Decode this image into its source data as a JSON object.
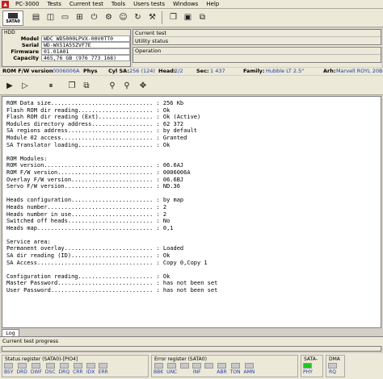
{
  "menu": [
    "PC-3000",
    "Tests",
    "Current test",
    "Tools",
    "Users tests",
    "Windows",
    "Help"
  ],
  "toolbar": {
    "sata_label": "SATA0"
  },
  "hdd": {
    "title": "HDD",
    "rows": [
      {
        "label": "Model",
        "value": "WDC WD5000LPVX-00V0TT0"
      },
      {
        "label": "Serial",
        "value": "WD-WX51A55ZVF7E"
      },
      {
        "label": "Firmware",
        "value": "01.01A01"
      },
      {
        "label": "Capacity",
        "value": "465,76 GB (976 773 168)"
      }
    ]
  },
  "current_test": {
    "header": "Current test",
    "value": "Utility status"
  },
  "operation": {
    "header": "Operation",
    "value": ""
  },
  "statusline": {
    "rom_label": "ROM F/W version",
    "rom_value": "0006006A",
    "phys_label": "Phys",
    "cyl_label": "Cyl SA:",
    "cyl_value": "256 (124)",
    "head_label": "Head:",
    "head_value": "2/2",
    "sec_label": "Sec:",
    "sec_value": "1 437",
    "family_label": "Family:",
    "family_value": "Hubble LT 2.5\"",
    "arh_label": "Arh:",
    "arh_value": "Marvell ROYL 20B"
  },
  "console_lines": [
    "ROM Data size.............................. : 256 Kb",
    "Flash ROM dir reading...................... : Ok",
    "Flash ROM dir reading (Ext)................ : Ok (Active)",
    "Modules directory address.................. : 62 372",
    "SA regions address......................... : by default",
    "Module 02 access........................... : Granted",
    "SA Translator loading...................... : Ok",
    "",
    "ROM Modules:",
    "ROM version................................ : 06.6AJ",
    "ROM F/W version............................ : 0006006A",
    "Overlay F/W version........................ : 06.6BJ",
    "Servo F/W version.......................... : ND.36",
    "",
    "Heads configuration........................ : by map",
    "Heads number............................... : 2",
    "Heads number in use........................ : 2",
    "Switched off heads......................... : No",
    "Heads map.................................. : 0,1",
    "",
    "Service area:",
    "Permanent overlay.......................... : Loaded",
    "SA dir reading (ID)........................ : Ok",
    "SA Access.................................. : Copy 0,Copy 1",
    "",
    "Configuration reading...................... : Ok",
    "Master Password............................ : has not been set",
    "User Password.............................. : has not been set"
  ],
  "log_tab": "Log",
  "progress_label": "Current test progress",
  "status_register": {
    "caption": "Status register (SATA0)-[PIO4]",
    "leds": [
      {
        "name": "BSY",
        "on": false
      },
      {
        "name": "DRD",
        "on": false
      },
      {
        "name": "DWF",
        "on": false
      },
      {
        "name": "DSC",
        "on": false
      },
      {
        "name": "DRQ",
        "on": false
      },
      {
        "name": "CRR",
        "on": false
      },
      {
        "name": "IDX",
        "on": false
      },
      {
        "name": "ERR",
        "on": false
      }
    ]
  },
  "error_register": {
    "caption": "Error register (SATA0)",
    "leds": [
      {
        "name": "BBK",
        "on": false
      },
      {
        "name": "UNC",
        "on": false
      },
      {
        "name": "",
        "on": false
      },
      {
        "name": "INF",
        "on": false
      },
      {
        "name": "",
        "on": false
      },
      {
        "name": "ABR",
        "on": false
      },
      {
        "name": "TON",
        "on": false
      },
      {
        "name": "AMN",
        "on": false
      }
    ]
  },
  "sata_ii": {
    "caption": "SATA-II",
    "leds": [
      {
        "name": "PHY",
        "on": true
      }
    ]
  },
  "dma": {
    "caption": "DMA",
    "leds": [
      {
        "name": "RQ",
        "on": false
      }
    ]
  }
}
